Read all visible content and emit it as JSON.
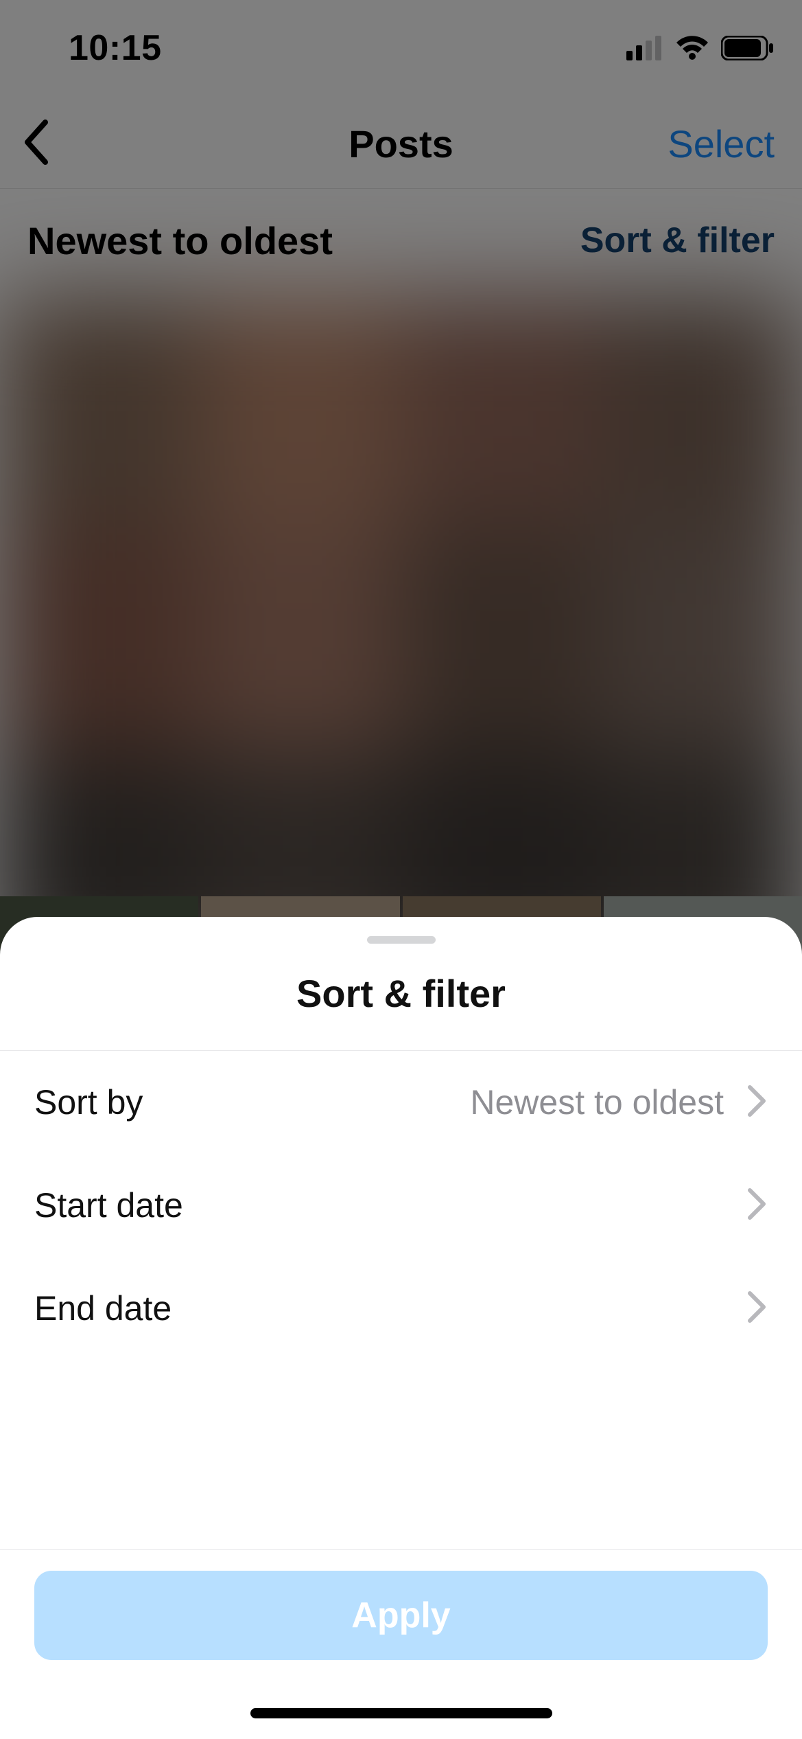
{
  "status": {
    "time": "10:15"
  },
  "nav": {
    "title": "Posts",
    "select_label": "Select"
  },
  "subhead": {
    "sort_label": "Newest to oldest",
    "filter_label": "Sort & filter"
  },
  "sheet": {
    "title": "Sort & filter",
    "rows": {
      "sort_by": {
        "label": "Sort by",
        "value": "Newest to oldest"
      },
      "start_date": {
        "label": "Start date"
      },
      "end_date": {
        "label": "End date"
      }
    },
    "apply_label": "Apply"
  },
  "colors": {
    "accent": "#1a8cff",
    "apply_bg": "#b7dfff"
  }
}
